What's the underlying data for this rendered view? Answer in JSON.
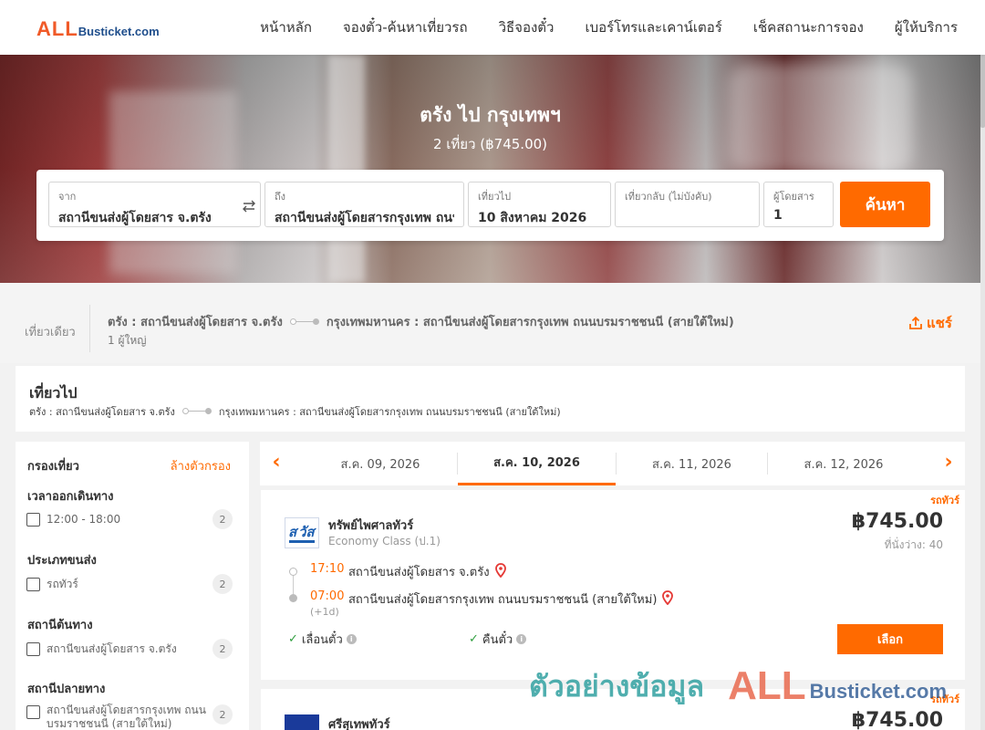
{
  "header": {
    "logo_all": "ALL",
    "logo_rest": "Busticket.com",
    "nav": [
      "หน้าหลัก",
      "จองตั๋ว-ค้นหาเที่ยวรถ",
      "วิธีจองตั๋ว",
      "เบอร์โทรและเคาน์เตอร์",
      "เช็คสถานะการจอง",
      "ผู้ให้บริการ"
    ]
  },
  "hero": {
    "title": "ตรัง ไป กรุงเทพฯ",
    "subtitle": "2 เที่ยว (฿745.00)"
  },
  "search": {
    "from_label": "จาก",
    "from_value": "สถานีขนส่งผู้โดยสาร จ.ตรัง",
    "to_label": "ถึง",
    "to_value": "สถานีขนส่งผู้โดยสารกรุงเทพ ถนนบรมราชชนนี",
    "depart_label": "เที่ยวไป",
    "depart_value": "10 สิงหาคม 2026",
    "return_label": "เที่ยวกลับ (ไม่บังคับ)",
    "return_value": "",
    "pax_label": "ผู้โดยสาร",
    "pax_value": "1",
    "button": "ค้นหา"
  },
  "summary": {
    "trip_type": "เที่ยวเดียว",
    "from": "ตรัง : สถานีขนส่งผู้โดยสาร จ.ตรัง",
    "to": "กรุงเทพมหานคร : สถานีขนส่งผู้โดยสารกรุงเทพ ถนนบรมราชชนนี (สายใต้ใหม่)",
    "pax": "1 ผู้ใหญ่",
    "share": "แชร์"
  },
  "outbound": {
    "title": "เที่ยวไป",
    "from": "ตรัง : สถานีขนส่งผู้โดยสาร จ.ตรัง",
    "to": "กรุงเทพมหานคร : สถานีขนส่งผู้โดยสารกรุงเทพ ถนนบรมราชชนนี (สายใต้ใหม่)"
  },
  "filter": {
    "title": "กรองเที่ยว",
    "clear": "ล้างตัวกรอง",
    "groups": [
      {
        "title": "เวลาออกเดินทาง",
        "label": "12:00 - 18:00",
        "count": "2"
      },
      {
        "title": "ประเภทขนส่ง",
        "label": "รถทัวร์",
        "count": "2"
      },
      {
        "title": "สถานีต้นทาง",
        "label": "สถานีขนส่งผู้โดยสาร จ.ตรัง",
        "count": "2"
      },
      {
        "title": "สถานีปลายทาง",
        "label": "สถานีขนส่งผู้โดยสารกรุงเทพ ถนนบรมราชชนนี (สายใต้ใหม่)",
        "count": "2"
      }
    ]
  },
  "dates": {
    "tabs": [
      "ส.ค. 09, 2026",
      "ส.ค. 10, 2026",
      "ส.ค. 11, 2026",
      "ส.ค. 12, 2026"
    ],
    "active_index": 1
  },
  "trips": [
    {
      "tag": "รถทัวร์",
      "operator": "ทรัพย์ไพศาลทัวร์",
      "class": "Economy Class (ป.1)",
      "price": "฿745.00",
      "seats": "ที่นั่งว่าง: 40",
      "depart_time": "17:10",
      "depart_stop": "สถานีขนส่งผู้โดยสาร จ.ตรัง",
      "arrive_time": "07:00",
      "arrive_stop": "สถานีขนส่งผู้โดยสารกรุงเทพ ถนนบรมราชชนนี (สายใต้ใหม่)",
      "day_offset": "(+1d)",
      "feature_1": "เลื่อนตั๋ว",
      "feature_2": "คืนตั๋ว",
      "select": "เลือก"
    },
    {
      "tag": "รถทัวร์",
      "operator": "ศรีสุเทพทัวร์",
      "price": "฿745.00"
    }
  ],
  "watermark": {
    "text": "ตัวอย่างข้อมูล",
    "all": "ALL",
    "rest": "Busticket.com"
  },
  "colors": {
    "accent": "#ff6a00",
    "brand_blue": "#1f4e8c",
    "pin": "#e53935"
  }
}
